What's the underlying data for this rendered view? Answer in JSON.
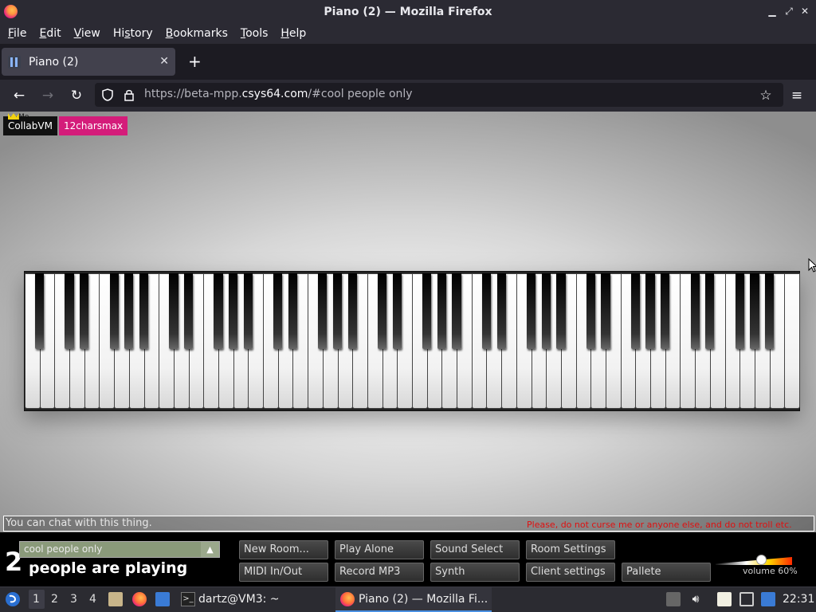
{
  "window": {
    "title": "Piano (2) — Mozilla Firefox",
    "controls": [
      "minimize-icon",
      "maximize-icon",
      "close-icon"
    ]
  },
  "menubar": [
    {
      "label": "File",
      "key": "F"
    },
    {
      "label": "Edit",
      "key": "E"
    },
    {
      "label": "View",
      "key": "V"
    },
    {
      "label": "History",
      "key": "s"
    },
    {
      "label": "Bookmarks",
      "key": "B"
    },
    {
      "label": "Tools",
      "key": "T"
    },
    {
      "label": "Help",
      "key": "H"
    }
  ],
  "tabs": [
    {
      "label": "Piano (2)",
      "active": true
    }
  ],
  "new_tab": "+",
  "url": {
    "prefix": "https://beta-mpp.",
    "host": "csys64.com",
    "suffix": "/#cool people only"
  },
  "page": {
    "users": [
      {
        "name": "CollabVM",
        "tag": "Me",
        "color": "#111111",
        "owner": true
      },
      {
        "name": "12charsmax",
        "color": "#d41c7a"
      }
    ],
    "piano": {
      "white_keys": 52,
      "black_key_pattern": "A-B C-D-E F-G-A"
    },
    "chat": {
      "placeholder": "You can chat with this thing.",
      "warning": "Please, do not curse me or anyone else, and do not troll etc."
    },
    "people_count": "2",
    "people_label": "people are playing",
    "room": {
      "name": "cool people only",
      "arrow": "▲"
    },
    "buttons": [
      {
        "label": "New Room...",
        "name": "new-room-button"
      },
      {
        "label": "Play Alone",
        "name": "play-alone-button"
      },
      {
        "label": "Sound Select",
        "name": "sound-select-button"
      },
      {
        "label": "Room Settings",
        "name": "room-settings-button"
      },
      {
        "label": "MIDI In/Out",
        "name": "midi-in-out-button"
      },
      {
        "label": "Record MP3",
        "name": "record-mp3-button"
      },
      {
        "label": "Synth",
        "name": "synth-button"
      },
      {
        "label": "Client settings",
        "name": "client-settings-button"
      },
      {
        "label": "Pallete",
        "name": "pallete-button"
      }
    ],
    "volume": {
      "label": "volume 60%",
      "value": 0.6
    }
  },
  "taskbar": {
    "workspaces": [
      "1",
      "2",
      "3",
      "4"
    ],
    "active_workspace": "1",
    "terminal_label": "dartz@VM3: ~",
    "firefox_label": "Piano (2) — Mozilla Fi...",
    "clock": "22:31"
  }
}
